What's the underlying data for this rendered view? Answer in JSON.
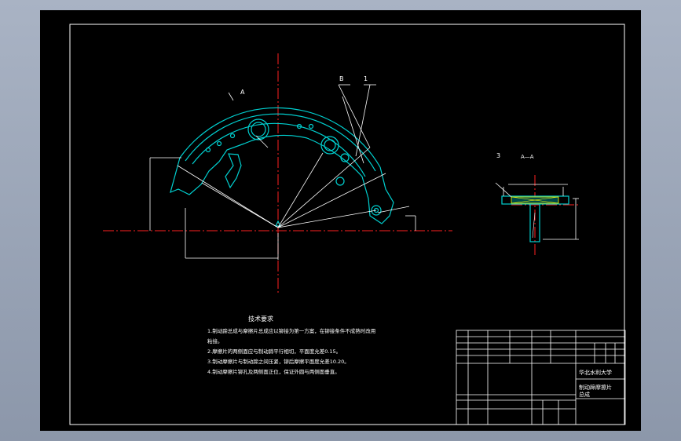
{
  "drawing": {
    "section_title": "A—A",
    "labels": {
      "a": "A",
      "b": "B",
      "c": "1",
      "d": "3"
    },
    "notes": {
      "heading": "技术要求",
      "lines": [
        "1.制动蹄总成与摩擦片总成应以铆接为第一方案，在铆接条件不成熟时改用",
        "粘接。",
        "2.摩擦片的两侧面应与制动蹄平行相切，平面度允差0.15。",
        "3.制动摩擦片与制动蹄之间压紧，铆后摩擦平面度允差10.20。",
        "4.制动摩擦片铆孔及两侧面正位，保证外圆与两侧面垂直。"
      ]
    },
    "title_block": {
      "school": "华北水利大学",
      "part_name": "制动蹄摩擦片",
      "part_sub": "总成"
    }
  },
  "colors": {
    "sheet": "#000000",
    "line": "#ffffff",
    "part": "#00d0d0",
    "center": "#ff2020",
    "dim": "#ffffff",
    "mark": "#ffff00"
  }
}
